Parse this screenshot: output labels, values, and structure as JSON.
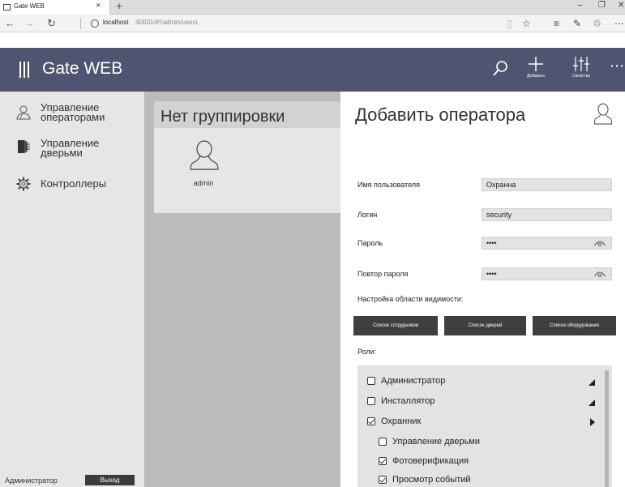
{
  "browser": {
    "tab_title": "Gate WEB",
    "tab_close": "×",
    "new_tab": "+",
    "url_host": "localhost",
    "url_path": ":40001/#!/admin/users",
    "window_controls": [
      "–",
      "❐",
      "✕"
    ],
    "nav": {
      "back": "←",
      "forward": "→",
      "refresh": "↻"
    },
    "tools": [
      "▯",
      "☆",
      "≡",
      "✎",
      "♲",
      "⋯"
    ]
  },
  "header": {
    "title": "Gate WEB",
    "add_label": "Добавить",
    "props_label": "Свойства",
    "more": "⋯",
    "color": "#4f5571"
  },
  "sidebar": {
    "items": [
      {
        "line1": "Управление",
        "line2": "операторами",
        "icon": "operators-icon"
      },
      {
        "line1": "Управление",
        "line2": "дверьми",
        "icon": "door-icon"
      },
      {
        "line1": "Контроллеры",
        "line2": "",
        "icon": "gear-icon"
      }
    ],
    "user_role": "Администратор",
    "logout": "Выход"
  },
  "center": {
    "group_title": "Нет группировки",
    "users": [
      {
        "name": "admin"
      }
    ]
  },
  "panel": {
    "title": "Добавить оператора",
    "fields": {
      "username": {
        "label": "Имя пользователя",
        "value": "Охранна"
      },
      "login": {
        "label": "Логин",
        "value": "security"
      },
      "password": {
        "label": "Пароль",
        "value": "••••"
      },
      "password_repeat": {
        "label": "Повтор пароля",
        "value": "••••"
      }
    },
    "scope_label": "Настройка области видимости:",
    "scope_buttons": [
      "Список сотрудников",
      "Список дверей",
      "Список оборудования"
    ],
    "roles_label": "Роли:",
    "roles": [
      {
        "label": "Администратор",
        "checked": false,
        "expander": "down"
      },
      {
        "label": "Инсталлятор",
        "checked": false,
        "expander": "down"
      },
      {
        "label": "Охранник",
        "checked": true,
        "expander": "right"
      },
      {
        "label": "Управление дверьми",
        "checked": false,
        "expander": ""
      },
      {
        "label": "Фотоверификация",
        "checked": true,
        "expander": ""
      },
      {
        "label": "Просмотр событий",
        "checked": true,
        "expander": ""
      }
    ]
  }
}
